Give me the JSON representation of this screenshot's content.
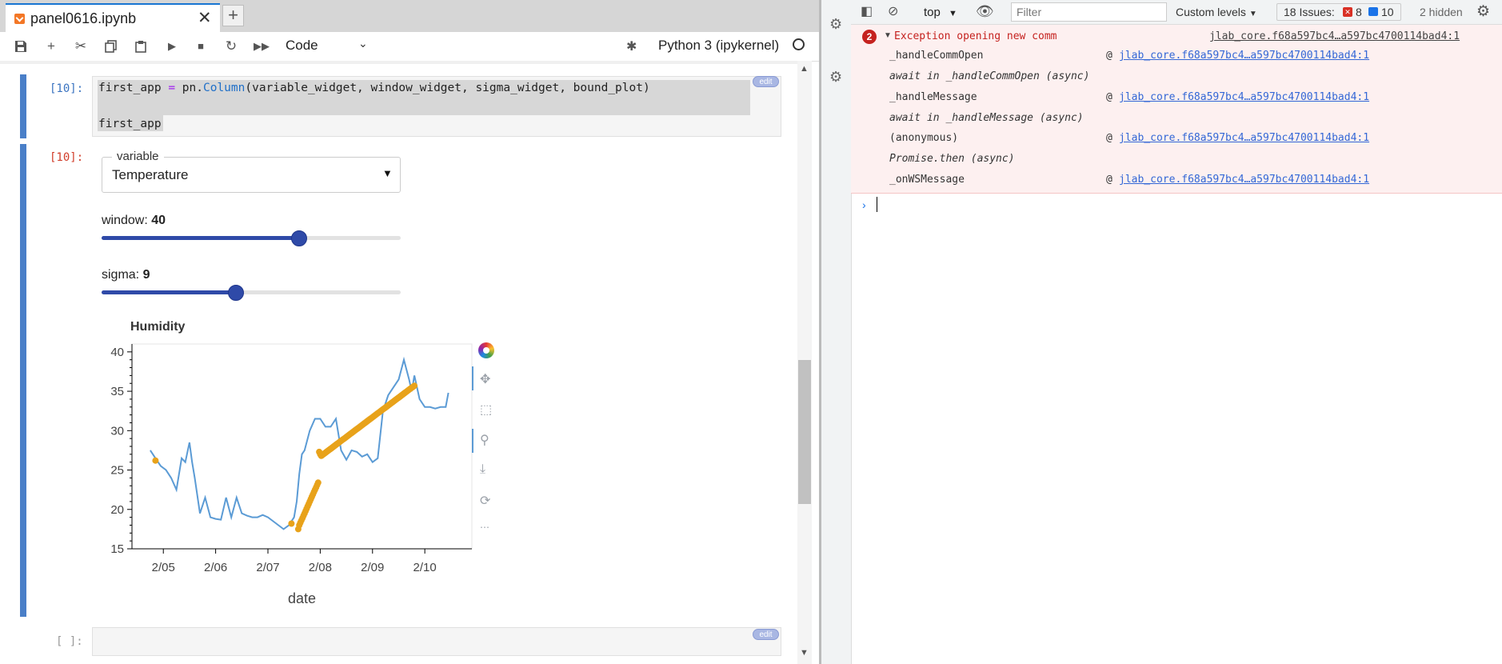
{
  "notebook": {
    "tab_title": "panel0616.ipynb",
    "tab_close": "✕",
    "new_tab": "+",
    "toolbar": {
      "cell_type": "Code",
      "kernel_name": "Python 3 (ipykernel)"
    },
    "cells": {
      "input_prompt": "[10]:",
      "output_prompt": "[10]:",
      "empty_prompt": "[ ]:",
      "edit_label": "edit",
      "code_line1_parts": [
        "first_app ",
        "=",
        " pn",
        ".",
        "Column",
        "(variable_widget, window_widget, sigma_widget, bound_plot)"
      ],
      "code_line2": "first_app"
    },
    "widgets": {
      "select_label": "variable",
      "select_value": "Temperature",
      "window_label": "window: ",
      "window_value": "40",
      "window_fraction": 0.66,
      "sigma_label": "sigma: ",
      "sigma_value": "9",
      "sigma_fraction": 0.45
    }
  },
  "chart_data": {
    "type": "line",
    "title": "Humidity",
    "xlabel": "date",
    "ylabel": "",
    "x_ticks": [
      "2/05",
      "2/06",
      "2/07",
      "2/08",
      "2/09",
      "2/10"
    ],
    "y_ticks": [
      15,
      20,
      25,
      30,
      35,
      40
    ],
    "ylim": [
      15,
      41
    ],
    "series": [
      {
        "color": "#5b9bd5",
        "x": [
          4.75,
          4.85,
          4.95,
          5.05,
          5.15,
          5.25,
          5.35,
          5.42,
          5.5,
          5.55,
          5.6,
          5.7,
          5.8,
          5.9,
          6.0,
          6.1,
          6.2,
          6.3,
          6.4,
          6.5,
          6.6,
          6.7,
          6.8,
          6.9,
          7.0,
          7.1,
          7.2,
          7.3,
          7.4,
          7.5,
          7.55,
          7.6,
          7.65,
          7.7,
          7.8,
          7.9,
          8.0,
          8.1,
          8.2,
          8.3,
          8.4,
          8.5,
          8.6,
          8.7,
          8.8,
          8.9,
          9.0,
          9.1,
          9.2,
          9.3,
          9.4,
          9.5,
          9.6,
          9.7,
          9.75,
          9.8,
          9.9,
          10.0,
          10.1,
          10.2,
          10.3,
          10.4,
          10.45
        ],
        "y": [
          27.5,
          26.5,
          25.5,
          25,
          24,
          22.5,
          26.5,
          26,
          28.5,
          26,
          24,
          19.5,
          21.5,
          19,
          18.8,
          18.7,
          21.5,
          19,
          21.5,
          19.5,
          19.2,
          19,
          19,
          19.3,
          19,
          18.5,
          18,
          17.5,
          18,
          19,
          21,
          24.5,
          27,
          27.5,
          30,
          31.5,
          31.5,
          30.5,
          30.5,
          31.5,
          27.5,
          26.3,
          27.5,
          27.3,
          26.7,
          27,
          26,
          26.5,
          32.5,
          34.5,
          35.5,
          36.5,
          39,
          36.5,
          35,
          37,
          34,
          33,
          33,
          32.8,
          33,
          33,
          34.8
        ]
      }
    ],
    "selection": {
      "color": "#e8a21a",
      "x": [
        4.85,
        7.45,
        7.58,
        7.6,
        7.62,
        7.64,
        7.66,
        7.68,
        7.7,
        7.72,
        7.74,
        7.76,
        7.78,
        7.8,
        7.82,
        7.84,
        7.86,
        7.88,
        7.9,
        7.92,
        7.94,
        7.96,
        7.98,
        8.0,
        8.02,
        8.04,
        8.06,
        8.08,
        8.1,
        8.12,
        8.14,
        8.16,
        8.18,
        8.2,
        8.22,
        8.24,
        8.26,
        8.28,
        8.3,
        8.32,
        8.34,
        8.36,
        8.38,
        8.4,
        8.42,
        8.44,
        8.46,
        8.48,
        8.5,
        8.52,
        8.54,
        8.56,
        8.58,
        8.6,
        8.62,
        8.64,
        8.66,
        8.68,
        8.7,
        8.72,
        8.74,
        8.76,
        8.78,
        8.8,
        8.82,
        8.84,
        8.86,
        8.88,
        8.9,
        8.92,
        8.94,
        8.96,
        8.98,
        9.0,
        9.02,
        9.04,
        9.06,
        9.08,
        9.1,
        9.12,
        9.14,
        9.16,
        9.18,
        9.2,
        9.22,
        9.24,
        9.26,
        9.28,
        9.3,
        9.32,
        9.34,
        9.36,
        9.38,
        9.4,
        9.42,
        9.44,
        9.46,
        9.48,
        9.5,
        9.52,
        9.54,
        9.56,
        9.58,
        9.6,
        9.62,
        9.64,
        9.66,
        9.68,
        9.7,
        9.72,
        9.74,
        9.76,
        9.78,
        9.8
      ],
      "y": [
        26.2,
        18.2,
        17.5,
        18.0,
        18.3,
        18.6,
        18.9,
        19.2,
        19.5,
        19.8,
        20.1,
        20.4,
        20.7,
        21.0,
        21.3,
        21.6,
        21.9,
        22.2,
        22.5,
        22.8,
        23.1,
        23.4,
        27.3,
        27.0,
        26.8,
        26.9,
        27.0,
        27.1,
        27.2,
        27.3,
        27.4,
        27.5,
        27.6,
        27.7,
        27.8,
        27.9,
        28.0,
        28.1,
        28.2,
        28.3,
        28.4,
        28.5,
        28.6,
        28.7,
        28.8,
        28.9,
        29.0,
        29.1,
        29.2,
        29.3,
        29.4,
        29.5,
        29.6,
        29.7,
        29.8,
        29.9,
        30.0,
        30.1,
        30.2,
        30.3,
        30.4,
        30.5,
        30.6,
        30.7,
        30.8,
        30.9,
        31.0,
        31.1,
        31.2,
        31.3,
        31.4,
        31.5,
        31.6,
        31.7,
        31.8,
        31.9,
        32.0,
        32.1,
        32.2,
        32.3,
        32.4,
        32.5,
        32.6,
        32.7,
        32.8,
        32.9,
        33.0,
        33.1,
        33.2,
        33.3,
        33.4,
        33.5,
        33.6,
        33.7,
        33.8,
        33.9,
        34.0,
        34.1,
        34.2,
        34.3,
        34.4,
        34.5,
        34.6,
        34.7,
        34.8,
        34.9,
        35.0,
        35.1,
        35.2,
        35.3,
        35.4,
        35.5,
        35.6,
        35.7
      ]
    },
    "grid": false
  },
  "devtools": {
    "context": "top",
    "filter_placeholder": "Filter",
    "levels": "Custom levels",
    "issues_label": "18 Issues:",
    "issues_errors": "8",
    "issues_info": "10",
    "hidden": "2 hidden",
    "error_count": "2",
    "error_message": "Exception opening new comm",
    "error_source": "jlab_core.f68a597bc4…a597bc4700114bad4:1",
    "stack": [
      {
        "fn": "_handleCommOpen",
        "link": "jlab_core.f68a597bc4…a597bc4700114bad4:1"
      },
      {
        "async": "await in _handleCommOpen (async)"
      },
      {
        "fn": "_handleMessage",
        "link": "jlab_core.f68a597bc4…a597bc4700114bad4:1"
      },
      {
        "async": "await in _handleMessage (async)"
      },
      {
        "fn": "(anonymous)",
        "link": "jlab_core.f68a597bc4…a597bc4700114bad4:1"
      },
      {
        "async": "Promise.then (async)"
      },
      {
        "fn": "_onWSMessage",
        "link": "jlab_core.f68a597bc4…a597bc4700114bad4:1"
      }
    ],
    "at": "@",
    "prompt_caret": "›"
  }
}
